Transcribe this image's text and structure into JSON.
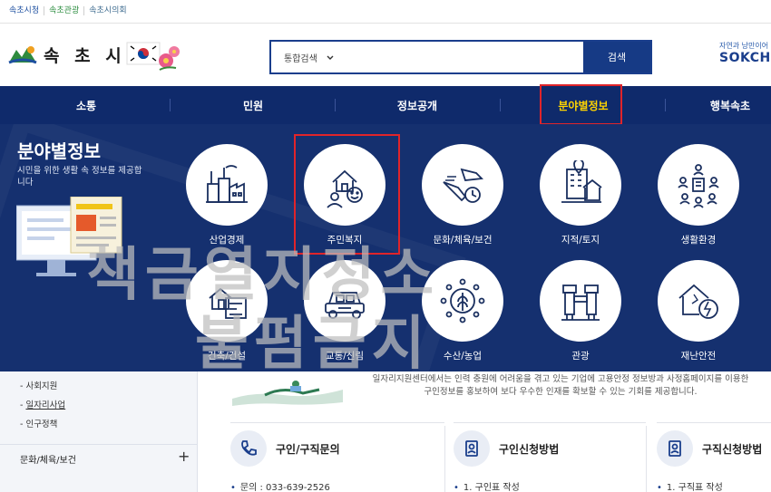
{
  "top_links": [
    "속초시청",
    "속초관광",
    "속초시의회"
  ],
  "logo": {
    "text": "속 초 시"
  },
  "search": {
    "scope": "통합검색",
    "button": "검색"
  },
  "brand": {
    "line1": "자연과 낭만이어",
    "line2": "SOKCHO"
  },
  "nav": {
    "items": [
      "소통",
      "민원",
      "정보공개",
      "분야별정보",
      "행복속초"
    ],
    "active": "분야별정보"
  },
  "mega": {
    "title": "분야별정보",
    "desc": "시민을 위한 생활 속 정보를 제공합니다",
    "categories": [
      {
        "label": "산업경제",
        "icon": "factory-icon"
      },
      {
        "label": "주민복지",
        "icon": "house-people-icon"
      },
      {
        "label": "문화/체육/보건",
        "icon": "sports-shoe-icon"
      },
      {
        "label": "지적/토지",
        "icon": "map-pin-building-icon"
      },
      {
        "label": "생활환경",
        "icon": "community-building-icon"
      },
      {
        "label": "건축/건설",
        "icon": "blueprint-house-icon"
      },
      {
        "label": "교통/신림",
        "icon": "car-icon"
      },
      {
        "label": "수산/농업",
        "icon": "grain-icon"
      },
      {
        "label": "관광",
        "icon": "binoculars-icon"
      },
      {
        "label": "재난안전",
        "icon": "house-crack-icon"
      }
    ]
  },
  "watermark": {
    "line1": "책금열지정소",
    "line2": "불펌금지"
  },
  "sidebar": {
    "items": [
      "사회지원",
      "일자리사업",
      "인구정책"
    ],
    "category": "문화/체육/보건",
    "plus": "+"
  },
  "content": {
    "intro_line1": "일자리지원센터에서는 인력 충원에 어려움을 겪고 있는 기업에 고용안정 정보방과 사정홈페이지를 이용한",
    "intro_line2": "구인정보를 홍보하여 보다 우수한 인재를 확보할 수 있는 기회를 제공합니다.",
    "cards": [
      {
        "title": "구인/구직문의",
        "line": "문의 : 033-639-2526"
      },
      {
        "title": "구인신청방법",
        "line": "1. 구인표 작성"
      },
      {
        "title": "구직신청방법",
        "line": "1. 구직표 작성"
      }
    ]
  },
  "colors": {
    "nav_bg": "#0f2a6b",
    "mega_bg": "#15306f",
    "active": "#ffd400",
    "highlight": "#e0242a"
  }
}
